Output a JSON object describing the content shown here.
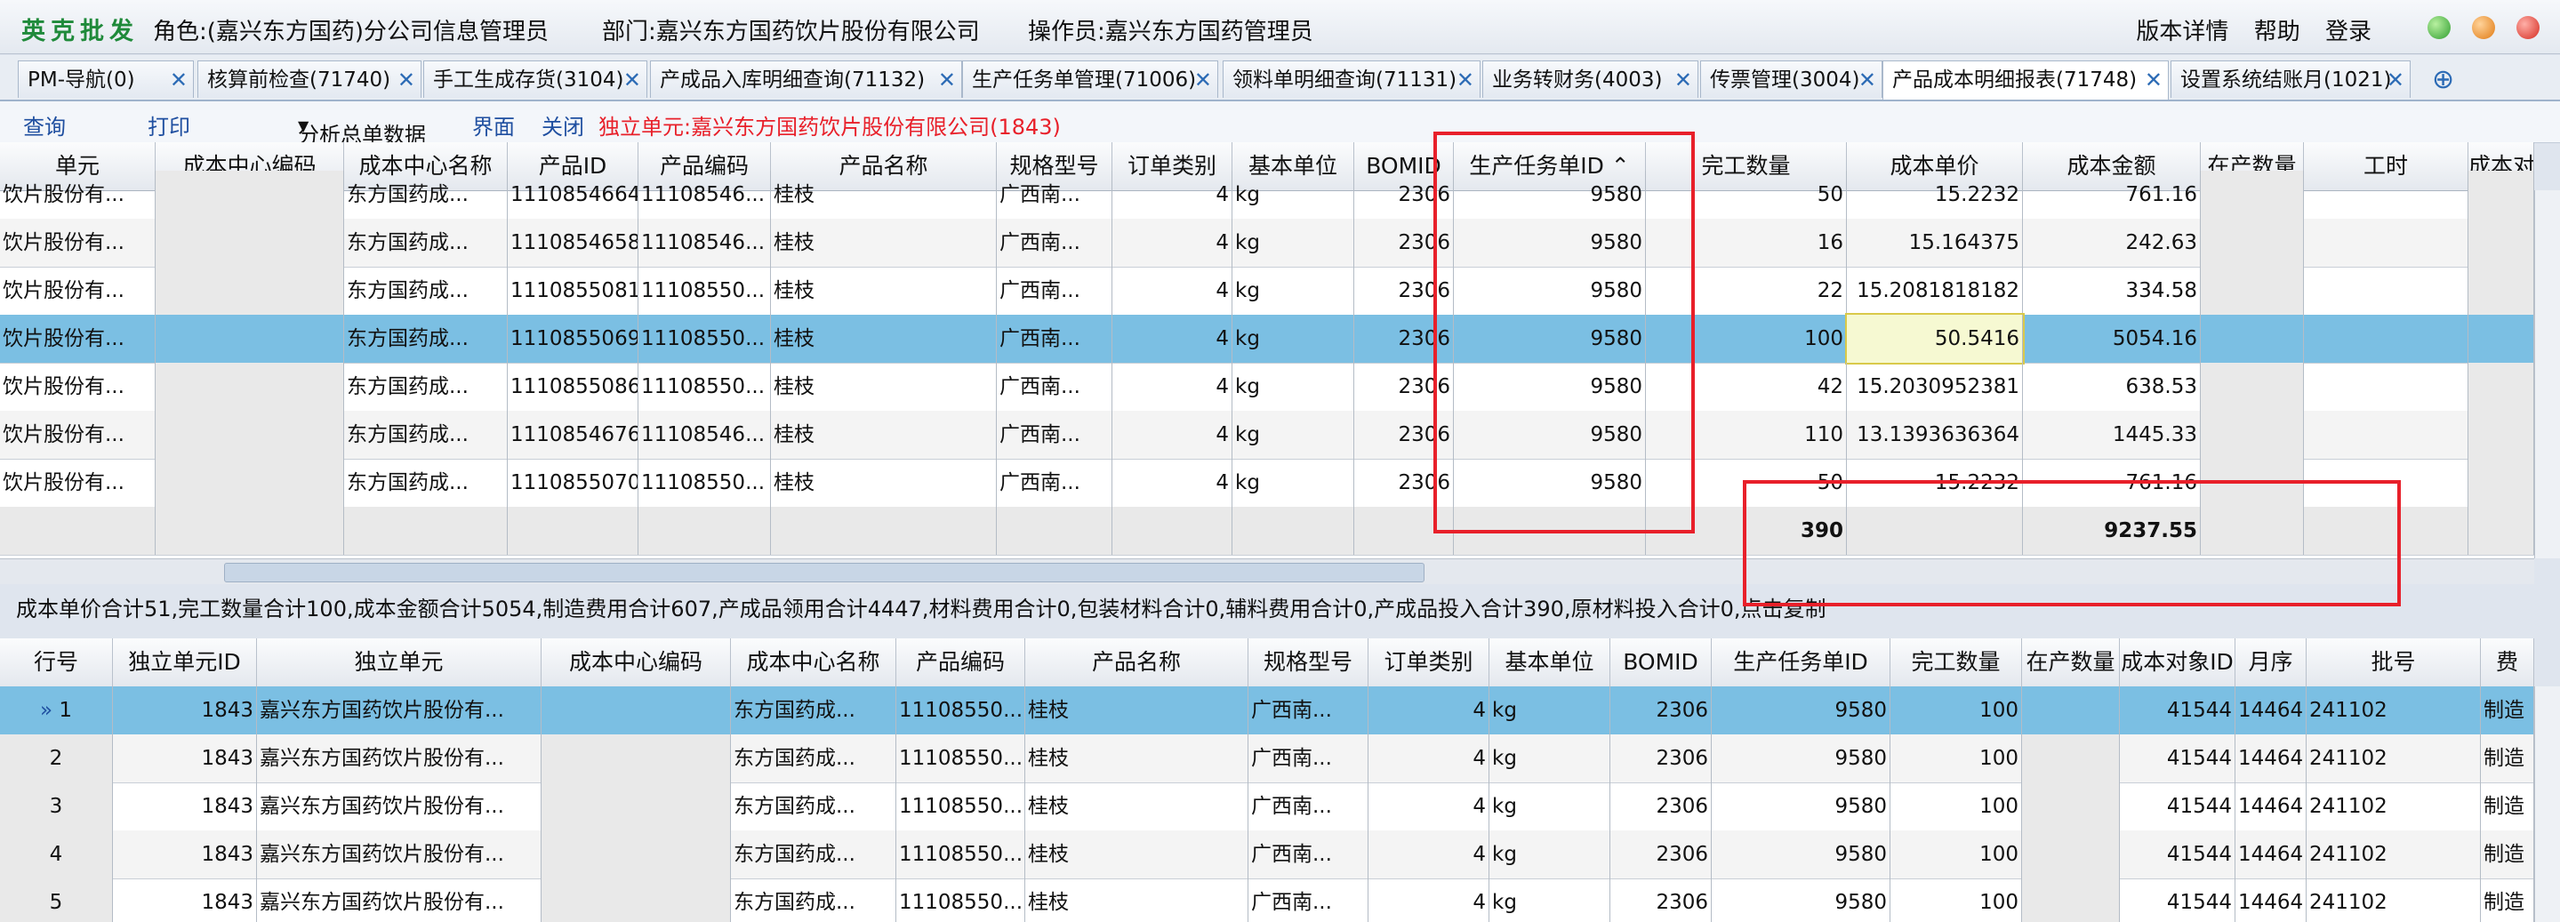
{
  "brand": "英克批发",
  "top": {
    "role": "角色:(嘉兴东方国药)分公司信息管理员",
    "dept": "部门:嘉兴东方国药饮片股份有限公司",
    "operator": "操作员:嘉兴东方国药管理员",
    "links": [
      "版本详情",
      "帮助",
      "登录"
    ]
  },
  "tabs": [
    "PM-导航(0)",
    "核算前检查(71740)",
    "手工生成存货(3104)",
    "产成品入库明细查询(71132)",
    "生产任务单管理(71006)",
    "领料单明细查询(71131)",
    "业务转财务(4003)",
    "传票管理(3004)",
    "产品成本明细报表(71748)",
    "设置系统结账月(1021)"
  ],
  "toolbar": {
    "query": "查询",
    "print": "打印",
    "analysis": "分析总单数据",
    "ui": "界面",
    "close": "关闭",
    "unit": "独立单元:嘉兴东方国药饮片股份有限公司(1843)"
  },
  "upper": {
    "headers": [
      "单元",
      "成本中心编码",
      "成本中心名称",
      "产品ID",
      "产品编码",
      "产品名称",
      "规格型号",
      "订单类别",
      "基本单位",
      "BOMID",
      "生产任务单ID",
      "完工数量",
      "成本单价",
      "成本金额",
      "在产数量",
      "工时",
      "成本对"
    ],
    "rows": [
      [
        "饮片股份有...",
        "",
        "东方国药成...",
        "1110854664",
        "11108546...",
        "桂枝",
        "广西南...",
        "4",
        "kg",
        "2306",
        "9580",
        "50",
        "15.2232",
        "761.16",
        "",
        "",
        ""
      ],
      [
        "饮片股份有...",
        "",
        "东方国药成...",
        "1110854658",
        "11108546...",
        "桂枝",
        "广西南...",
        "4",
        "kg",
        "2306",
        "9580",
        "16",
        "15.164375",
        "242.63",
        "",
        "",
        ""
      ],
      [
        "饮片股份有...",
        "",
        "东方国药成...",
        "1110855081",
        "11108550...",
        "桂枝",
        "广西南...",
        "4",
        "kg",
        "2306",
        "9580",
        "22",
        "15.2081818182",
        "334.58",
        "",
        "",
        ""
      ],
      [
        "饮片股份有...",
        "",
        "东方国药成...",
        "1110855069",
        "11108550...",
        "桂枝",
        "广西南...",
        "4",
        "kg",
        "2306",
        "9580",
        "100",
        "50.5416",
        "5054.16",
        "",
        "",
        ""
      ],
      [
        "饮片股份有...",
        "",
        "东方国药成...",
        "1110855086",
        "11108550...",
        "桂枝",
        "广西南...",
        "4",
        "kg",
        "2306",
        "9580",
        "42",
        "15.2030952381",
        "638.53",
        "",
        "",
        ""
      ],
      [
        "饮片股份有...",
        "",
        "东方国药成...",
        "1110854676",
        "11108546...",
        "桂枝",
        "广西南...",
        "4",
        "kg",
        "2306",
        "9580",
        "110",
        "13.1393636364",
        "1445.33",
        "",
        "",
        ""
      ],
      [
        "饮片股份有...",
        "",
        "东方国药成...",
        "1110855070",
        "11108550...",
        "桂枝",
        "广西南...",
        "4",
        "kg",
        "2306",
        "9580",
        "50",
        "15.2232",
        "761.16",
        "",
        "",
        ""
      ]
    ],
    "totals": {
      "qty": "390",
      "amount": "9237.55"
    }
  },
  "summary": "成本单价合计51,完工数量合计100,成本金额合计5054,制造费用合计607,产成品领用合计4447,材料费用合计0,包装材料合计0,辅料费用合计0,产成品投入合计390,原材料投入合计0,点击复制",
  "lower": {
    "headers": [
      "行号",
      "独立单元ID",
      "独立单元",
      "成本中心编码",
      "成本中心名称",
      "产品编码",
      "产品名称",
      "规格型号",
      "订单类别",
      "基本单位",
      "BOMID",
      "生产任务单ID",
      "完工数量",
      "在产数量",
      "成本对象ID",
      "月序",
      "批号",
      "费"
    ],
    "rows": [
      [
        "1",
        "1843",
        "嘉兴东方国药饮片股份有...",
        "",
        "东方国药成...",
        "11108550...",
        "桂枝",
        "广西南...",
        "4",
        "kg",
        "2306",
        "9580",
        "100",
        "",
        "41544",
        "14464",
        "241102",
        "制造"
      ],
      [
        "2",
        "1843",
        "嘉兴东方国药饮片股份有...",
        "",
        "东方国药成...",
        "11108550...",
        "桂枝",
        "广西南...",
        "4",
        "kg",
        "2306",
        "9580",
        "100",
        "",
        "41544",
        "14464",
        "241102",
        "制造"
      ],
      [
        "3",
        "1843",
        "嘉兴东方国药饮片股份有...",
        "",
        "东方国药成...",
        "11108550...",
        "桂枝",
        "广西南...",
        "4",
        "kg",
        "2306",
        "9580",
        "100",
        "",
        "41544",
        "14464",
        "241102",
        "制造"
      ],
      [
        "4",
        "1843",
        "嘉兴东方国药饮片股份有...",
        "",
        "东方国药成...",
        "11108550...",
        "桂枝",
        "广西南...",
        "4",
        "kg",
        "2306",
        "9580",
        "100",
        "",
        "41544",
        "14464",
        "241102",
        "制造"
      ],
      [
        "5",
        "1843",
        "嘉兴东方国药饮片股份有...",
        "",
        "东方国药成...",
        "11108550...",
        "桂枝",
        "广西南...",
        "4",
        "kg",
        "2306",
        "9580",
        "100",
        "",
        "41544",
        "14464",
        "241102",
        "制造"
      ]
    ]
  },
  "colors": {
    "selected_row": "#7bbfe3",
    "highlight": "#e8202a",
    "brand": "#1f8a3a"
  },
  "icons": {
    "tab_close": "close-icon",
    "tab_add": "add-tab-icon",
    "sort": "sort-up-icon"
  }
}
